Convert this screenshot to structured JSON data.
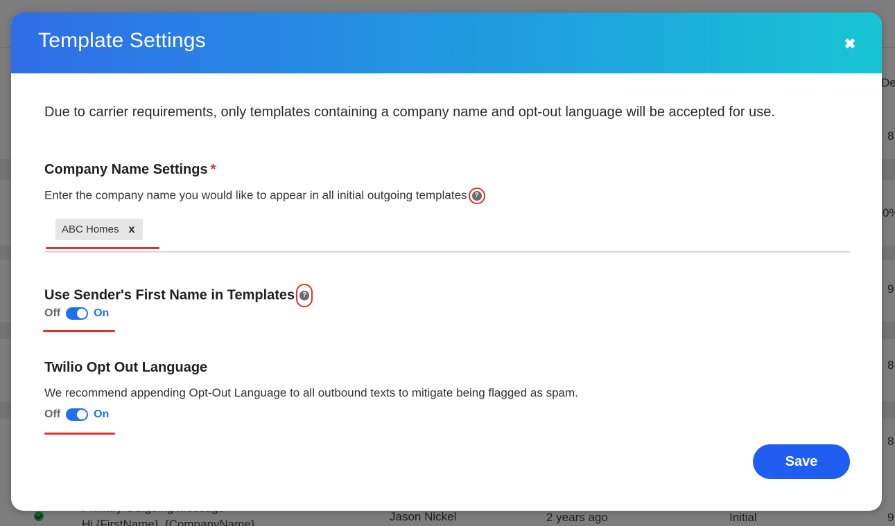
{
  "background": {
    "right_column": [
      "De",
      "8",
      "0%",
      "9",
      "8",
      "8",
      "9"
    ],
    "last_row": {
      "title": "Primary Outgoing Message",
      "subtitle": "Hi {FirstName}, {CompanyName}",
      "author": "Jason Nickel",
      "time": "2 years ago",
      "type": "Initial",
      "tail": "9"
    }
  },
  "modal": {
    "title": "Template Settings",
    "close_icon": "close-icon",
    "intro": "Due to carrier requirements, only templates containing a company name and opt-out language will be accepted for use.",
    "company_name": {
      "title": "Company Name Settings",
      "required_mark": "*",
      "description": "Enter the company name you would like to appear in all initial outgoing templates",
      "help_icon": "?",
      "tags": [
        {
          "label": "ABC Homes",
          "remove": "x"
        }
      ]
    },
    "sender_first_name": {
      "title": "Use Sender's First Name in Templates",
      "help_icon": "?",
      "off_label": "Off",
      "on_label": "On",
      "enabled": true
    },
    "opt_out": {
      "title": "Twilio Opt Out Language",
      "description": "We recommend appending Opt-Out Language to all outbound texts to mitigate being flagged as spam.",
      "off_label": "Off",
      "on_label": "On",
      "enabled": true
    },
    "save_label": "Save"
  },
  "colors": {
    "header_gradient_start": "#2f6ee8",
    "header_gradient_end": "#18c4d4",
    "accent": "#1f6ff0",
    "annotation_red": "#e0302b"
  }
}
